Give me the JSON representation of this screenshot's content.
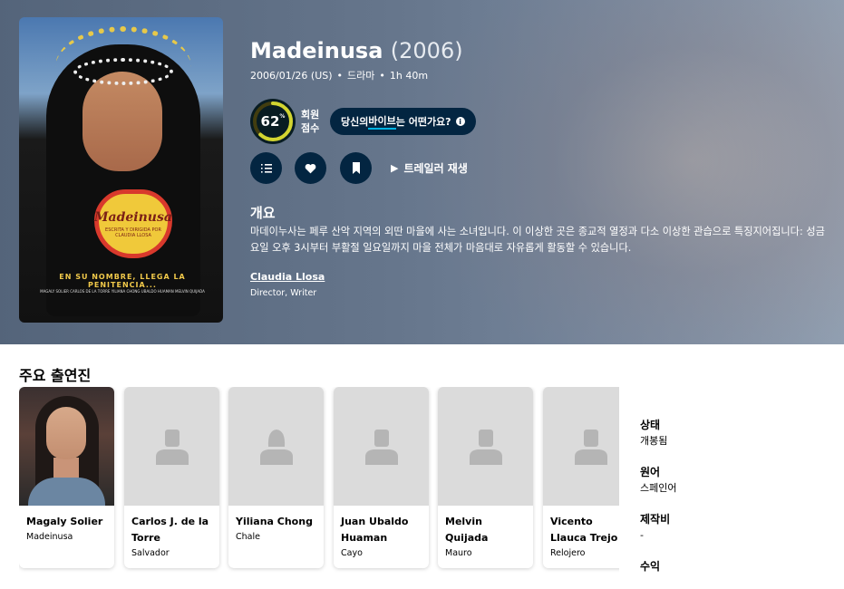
{
  "movie": {
    "title": "Madeinusa",
    "year": "(2006)",
    "release": "2006/01/26 (US)",
    "genre": "드라마",
    "runtime": "1h 40m",
    "score": "62",
    "score_unit": "%",
    "score_fraction": 0.62,
    "score_label": "회원 점수",
    "vibe_prefix": "당신의 ",
    "vibe_word": "바이브",
    "vibe_suffix": "는 어떤가요?",
    "trailer_label": "트레일러 재생",
    "overview_heading": "개요",
    "overview": "마데이누사는 페루 산악 지역의 외딴 마을에 사는 소녀입니다. 이 이상한 곳은 종교적 열정과 다소 이상한 관습으로 특징지어집니다: 성금요일 오후 3시부터 부활절 일요일까지 마을 전체가 마음대로 자유롭게 활동할 수 있습니다.",
    "crew": {
      "name": "Claudia Llosa",
      "job": "Director, Writer"
    }
  },
  "poster": {
    "title": "Madeinusa",
    "credit": "ESCRITA Y DIRIGIDA POR CLAUDIA LLOSA",
    "tagline": "EN SU NOMBRE, LLEGA LA PENITENCIA...",
    "cast_line": "MAGALY SOLIER  CARLOS DE LA TORRE  YILIANA CHONG  UBALDO HUAMAN  MELVIN QUIJADA"
  },
  "colors": {
    "dark_navy": "#032541",
    "score_ring": "#d2d531",
    "accent": "#01b4e4"
  },
  "cast_heading": "주요 출연진",
  "cast": [
    {
      "name": "Magaly Solier",
      "character": "Madeinusa",
      "photo": true,
      "gender": "female"
    },
    {
      "name": "Carlos J. de la Torre",
      "character": "Salvador",
      "photo": false,
      "gender": "male"
    },
    {
      "name": "Yiliana Chong",
      "character": "Chale",
      "photo": false,
      "gender": "female"
    },
    {
      "name": "Juan Ubaldo Huaman",
      "character": "Cayo",
      "photo": false,
      "gender": "male"
    },
    {
      "name": "Melvin Quijada",
      "character": "Mauro",
      "photo": false,
      "gender": "male"
    },
    {
      "name": "Vicento Llauca Trejo",
      "character": "Relojero",
      "photo": false,
      "gender": "male"
    }
  ],
  "facts": [
    {
      "label": "상태",
      "value": "개봉됨"
    },
    {
      "label": "원어",
      "value": "스페인어"
    },
    {
      "label": "제작비",
      "value": "-"
    },
    {
      "label": "수익",
      "value": ""
    }
  ]
}
